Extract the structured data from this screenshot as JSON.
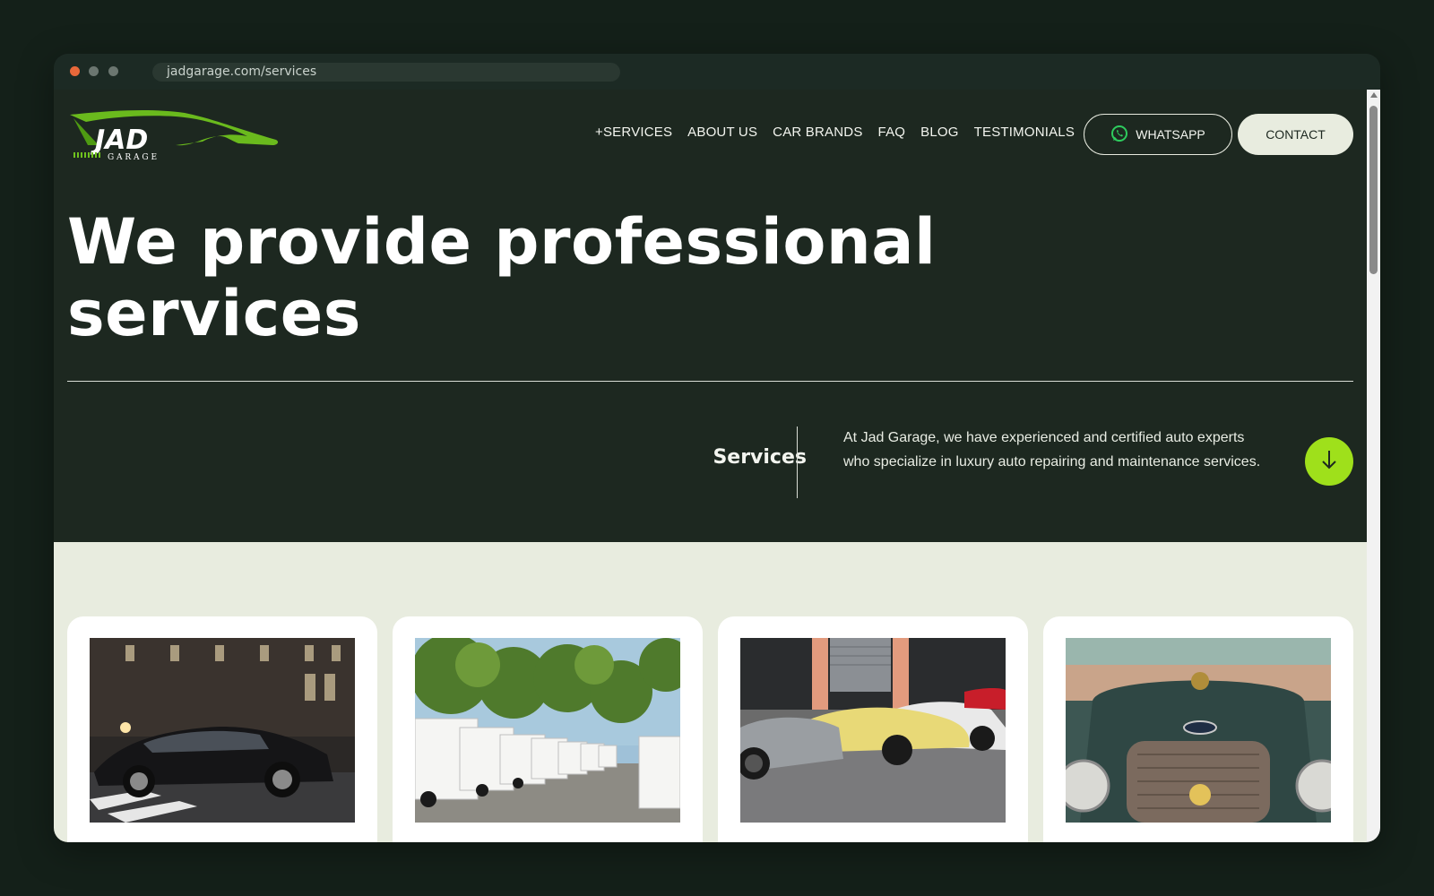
{
  "browser": {
    "url": "jadgarage.com/services"
  },
  "logo": {
    "text": "JAD",
    "subtext": "G A R A G E",
    "accent_color": "#6fc21e"
  },
  "nav": {
    "items": [
      {
        "label": "+SERVICES"
      },
      {
        "label": "ABOUT US"
      },
      {
        "label": "CAR BRANDS"
      },
      {
        "label": "FAQ"
      },
      {
        "label": "BLOG"
      },
      {
        "label": "TESTIMONIALS"
      }
    ],
    "whatsapp_label": "WHATSAPP",
    "whatsapp_icon": "whatsapp-icon",
    "contact_label": "CONTACT"
  },
  "hero": {
    "title_line1": "We provide professional",
    "title_line2": "services"
  },
  "intro": {
    "section_label": "Services",
    "text": "At Jad Garage, we have experienced and certified auto experts who specialize in luxury auto repairing and maintenance services.",
    "scroll_icon": "arrow-down-icon",
    "accent_color": "#9fe01b"
  },
  "cards": [
    {
      "image": "black-sedan-photo"
    },
    {
      "image": "white-vans-photo"
    },
    {
      "image": "sports-cars-photo"
    },
    {
      "image": "vintage-car-grille-photo"
    }
  ],
  "colors": {
    "dark_bg": "#1d2820",
    "light_bg": "#e8ecdf",
    "page_bg": "#142019"
  }
}
